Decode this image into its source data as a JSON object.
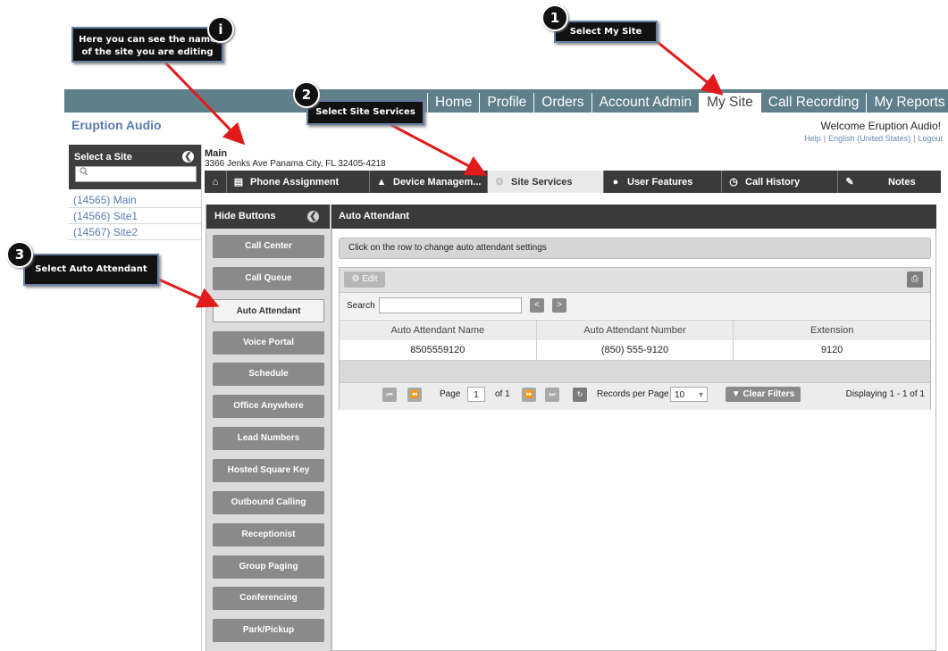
{
  "topnav": {
    "tabs": [
      "Home",
      "Profile",
      "Orders",
      "Account Admin",
      "My Site",
      "Call Recording",
      "My Reports"
    ],
    "active_index": 4
  },
  "brand": "Eruption Audio",
  "welcome": "Welcome Eruption Audio!",
  "toplinks": {
    "help": "Help",
    "language": "English (United States)",
    "logout": "Logout"
  },
  "site_panel": {
    "title": "Select a Site",
    "search_icon": "search-icon",
    "sites": [
      "(14565) Main",
      "(14566) Site1",
      "(14567) Site2"
    ]
  },
  "site": {
    "name": "Main",
    "address": "3366 Jenks Ave Panama City, FL 32405-4218",
    "dots": "...."
  },
  "subtabs": [
    {
      "label": "Phone Assignment",
      "icon": "phone-list-icon"
    },
    {
      "label": "Device Managem...",
      "icon": "bell-icon"
    },
    {
      "label": "Site Services",
      "icon": "gear-icon"
    },
    {
      "label": "User Features",
      "icon": "user-icon"
    },
    {
      "label": "Call History",
      "icon": "clock-icon"
    },
    {
      "label": "Notes",
      "icon": "pencil-icon"
    }
  ],
  "subtabs_active_index": 2,
  "left_buttons": {
    "hide_label": "Hide Buttons",
    "items": [
      "Call Center",
      "Call Queue",
      "Auto Attendant",
      "Voice Portal",
      "Schedule",
      "Office Anywhere",
      "Lead Numbers",
      "Hosted Square Key",
      "Outbound Calling",
      "Receptionist",
      "Group Paging",
      "Conferencing",
      "Park/Pickup"
    ],
    "active_index": 2
  },
  "main": {
    "title": "Auto Attendant",
    "hint": "Click on the row to change auto attendant settings",
    "edit_label": "Edit",
    "search_label": "Search",
    "search_value": "",
    "columns": [
      "Auto Attendant Name",
      "Auto Attendant Number",
      "Extension"
    ],
    "rows": [
      [
        "8505559120",
        "(850) 555-9120",
        "9120"
      ]
    ],
    "pager": {
      "page_label": "Page",
      "page_value": "1",
      "of_label": "of 1",
      "rpp_label": "Records per Page",
      "rpp_value": "10",
      "clear_filters": "Clear Filters",
      "displaying": "Displaying 1 - 1 of 1"
    }
  },
  "callouts": [
    {
      "badge": "i",
      "text": "Here you can see the name of the site you are editing"
    },
    {
      "badge": "1",
      "text": "Select My Site"
    },
    {
      "badge": "2",
      "text": "Select Site Services"
    },
    {
      "badge": "3",
      "text": "Select Auto Attendant"
    }
  ],
  "colors": {
    "accent_red": "#e01b1b",
    "nav_bg": "#5f7f8a",
    "dark_bar": "#3a3a3a",
    "link_blue": "#5a7bb0"
  }
}
